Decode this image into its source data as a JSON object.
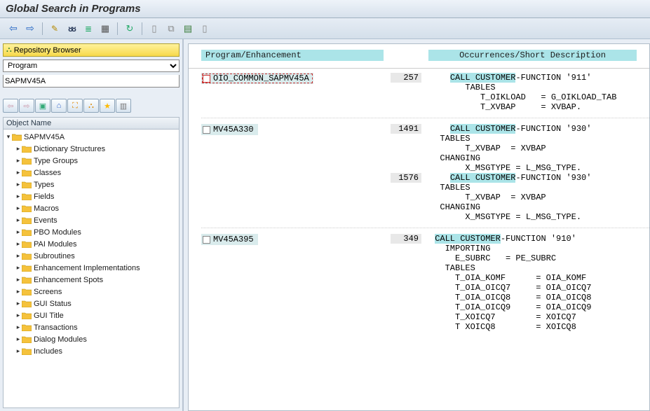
{
  "title": "Global Search in Programs",
  "toolbar": {
    "back": "⇦",
    "forward": "⇨",
    "edit": "✎",
    "display": "ᴕᴕ",
    "exec": "≣",
    "table": "▦",
    "refresh": "↻",
    "doc1": "▯",
    "doc2": "⧉",
    "list1": "▤",
    "list2": "▯"
  },
  "repo": {
    "header": "Repository Browser",
    "selector_value": "Program",
    "input_value": "SAPMV45A"
  },
  "mini_icons": [
    "⇦",
    "⇨",
    "▣",
    "⌂",
    "⛶",
    "⛬",
    "★",
    "▥"
  ],
  "objname_header": "Object Name",
  "tree": {
    "root": "SAPMV45A",
    "children": [
      "Dictionary Structures",
      "Type Groups",
      "Classes",
      "Types",
      "Fields",
      "Macros",
      "Events",
      "PBO Modules",
      "PAI Modules",
      "Subroutines",
      "Enhancement Implementations",
      "Enhancement Spots",
      "Screens",
      "GUI Status",
      "GUI Title",
      "Transactions",
      "Dialog Modules",
      "Includes"
    ]
  },
  "result_head": {
    "program": "Program/Enhancement",
    "desc": "Occurrences/Short Description"
  },
  "groups": [
    {
      "prog": "OIO_COMMON_SAPMV45A",
      "selected": true,
      "lines": [
        {
          "no": "257",
          "pre": "    ",
          "hl": "CALL CUSTOMER",
          "post": "-FUNCTION '911'"
        },
        {
          "no": "",
          "pre": "       TABLES",
          "hl": "",
          "post": ""
        },
        {
          "no": "",
          "pre": "          T_OIKLOAD   = G_OIKLOAD_TAB",
          "hl": "",
          "post": ""
        },
        {
          "no": "",
          "pre": "          T_XVBAP     = XVBAP.",
          "hl": "",
          "post": ""
        }
      ]
    },
    {
      "prog": "MV45A330",
      "selected": false,
      "lines": [
        {
          "no": "1491",
          "pre": "    ",
          "hl": "CALL CUSTOMER",
          "post": "-FUNCTION '930'"
        },
        {
          "no": "",
          "pre": "  TABLES",
          "hl": "",
          "post": ""
        },
        {
          "no": "",
          "pre": "       T_XVBAP  = XVBAP",
          "hl": "",
          "post": ""
        },
        {
          "no": "",
          "pre": "  CHANGING",
          "hl": "",
          "post": ""
        },
        {
          "no": "",
          "pre": "       X_MSGTYPE = L_MSG_TYPE.",
          "hl": "",
          "post": ""
        },
        {
          "no": "1576",
          "pre": "    ",
          "hl": "CALL CUSTOMER",
          "post": "-FUNCTION '930'"
        },
        {
          "no": "",
          "pre": "  TABLES",
          "hl": "",
          "post": ""
        },
        {
          "no": "",
          "pre": "       T_XVBAP  = XVBAP",
          "hl": "",
          "post": ""
        },
        {
          "no": "",
          "pre": "  CHANGING",
          "hl": "",
          "post": ""
        },
        {
          "no": "",
          "pre": "       X_MSGTYPE = L_MSG_TYPE.",
          "hl": "",
          "post": ""
        }
      ]
    },
    {
      "prog": "MV45A395",
      "selected": false,
      "lines": [
        {
          "no": "349",
          "pre": " ",
          "hl": "CALL CUSTOMER",
          "post": "-FUNCTION '910'"
        },
        {
          "no": "",
          "pre": "   IMPORTING",
          "hl": "",
          "post": ""
        },
        {
          "no": "",
          "pre": "     E_SUBRC   = PE_SUBRC",
          "hl": "",
          "post": ""
        },
        {
          "no": "",
          "pre": "   TABLES",
          "hl": "",
          "post": ""
        },
        {
          "no": "",
          "pre": "     T_OIA_KOMF      = OIA_KOMF",
          "hl": "",
          "post": ""
        },
        {
          "no": "",
          "pre": "     T_OIA_OICQ7     = OIA_OICQ7",
          "hl": "",
          "post": ""
        },
        {
          "no": "",
          "pre": "     T_OIA_OICQ8     = OIA_OICQ8",
          "hl": "",
          "post": ""
        },
        {
          "no": "",
          "pre": "     T_OIA_OICQ9     = OIA_OICQ9",
          "hl": "",
          "post": ""
        },
        {
          "no": "",
          "pre": "     T_XOICQ7        = XOICQ7",
          "hl": "",
          "post": ""
        },
        {
          "no": "",
          "pre": "     T XOICQ8        = XOICQ8",
          "hl": "",
          "post": ""
        }
      ]
    }
  ]
}
